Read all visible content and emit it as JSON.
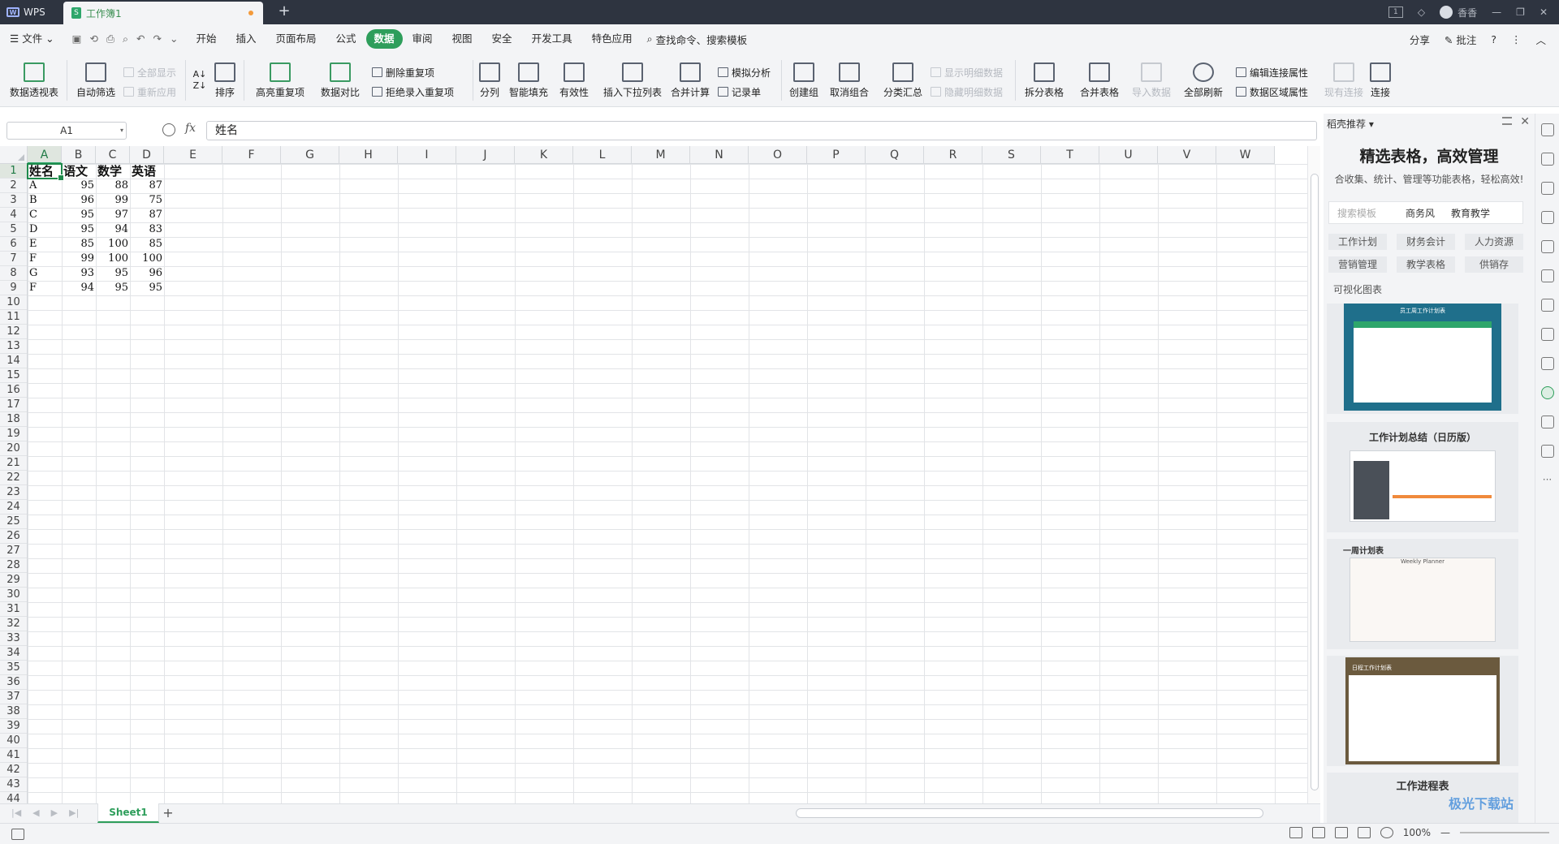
{
  "titlebar": {
    "app_label": "WPS",
    "doc_tab": "工作簿1",
    "user_name": "香香"
  },
  "menu": {
    "file": "文件",
    "items": [
      "开始",
      "插入",
      "页面布局",
      "公式",
      "数据",
      "审阅",
      "视图",
      "安全",
      "开发工具",
      "特色应用"
    ],
    "active": "数据",
    "search": "查找命令、搜索模板",
    "share": "分享",
    "annotate": "批注"
  },
  "ribbon": {
    "pivot": "数据透视表",
    "autofilter": "自动筛选",
    "show_all": "全部显示",
    "reapply": "重新应用",
    "sort": "排序",
    "highlight_dup": "高亮重复项",
    "compare": "数据对比",
    "remove_dup": "删除重复项",
    "reject_dup": "拒绝录入重复项",
    "split": "分列",
    "flash_fill": "智能填充",
    "validity": "有效性",
    "dropdown": "插入下拉列表",
    "consolidate": "合并计算",
    "what_if": "模拟分析",
    "record": "记录单",
    "group": "创建组",
    "ungroup": "取消组合",
    "subtotal": "分类汇总",
    "show_detail": "显示明细数据",
    "hide_detail": "隐藏明细数据",
    "split_table": "拆分表格",
    "merge_table": "合并表格",
    "import": "导入数据",
    "refresh_all": "全部刷新",
    "edit_conn": "编辑连接属性",
    "range_props": "数据区域属性",
    "existing_conn": "现有连接",
    "connect": "连接"
  },
  "formula": {
    "cell_ref": "A1",
    "fx": "fx",
    "content": "姓名"
  },
  "sheet": {
    "columns": [
      "A",
      "B",
      "C",
      "D",
      "E",
      "F",
      "G",
      "H",
      "I",
      "J",
      "K",
      "L",
      "M",
      "N",
      "O",
      "P",
      "Q",
      "R",
      "S",
      "T",
      "U",
      "V",
      "W"
    ],
    "headers": [
      "姓名",
      "语文",
      "数学",
      "英语"
    ],
    "rows": [
      [
        "A",
        "95",
        "88",
        "87"
      ],
      [
        "B",
        "96",
        "99",
        "75"
      ],
      [
        "C",
        "95",
        "97",
        "87"
      ],
      [
        "D",
        "95",
        "94",
        "83"
      ],
      [
        "E",
        "85",
        "100",
        "85"
      ],
      [
        "F",
        "99",
        "100",
        "100"
      ],
      [
        "G",
        "93",
        "95",
        "96"
      ],
      [
        "F",
        "94",
        "95",
        "95"
      ]
    ],
    "row_count": 44,
    "tab_name": "Sheet1"
  },
  "status": {
    "zoom": "100%"
  },
  "panel": {
    "header": "稻壳推荐",
    "title": "精选表格，高效管理",
    "subtitle": "合收集、统计、管理等功能表格，轻松高效!",
    "search_placeholder": "搜索模板",
    "search_tags": [
      "商务风",
      "教育教学"
    ],
    "tags": [
      "工作计划",
      "财务会计",
      "人力资源",
      "营销管理",
      "教学表格",
      "供销存"
    ],
    "category": "可视化图表",
    "cards": [
      "",
      "工作计划总结（日历版）",
      "",
      "",
      "工作进程表"
    ],
    "card1_inner": "员工周工作计划表",
    "card3_inner": "一周计划表",
    "card3_sub": "Weekly Planner",
    "card4_inner": "日程工作计划表",
    "watermark": "极光下载站"
  }
}
